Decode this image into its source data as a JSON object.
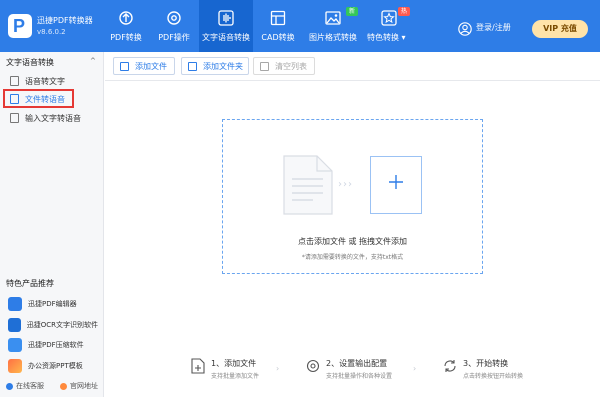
{
  "app": {
    "name": "迅捷PDF转换器",
    "version": "v8.6.0.2"
  },
  "nav": [
    {
      "label": "PDF转换"
    },
    {
      "label": "PDF操作"
    },
    {
      "label": "文字语音转换"
    },
    {
      "label": "CAD转换"
    },
    {
      "label": "图片格式转换",
      "badge": "新"
    },
    {
      "label": "特色转换 ▾",
      "badge": "热"
    }
  ],
  "header": {
    "login": "登录/注册",
    "vip": "VIP 充值"
  },
  "sidebar": {
    "section_title": "文字语音转换",
    "section_arrow": "^",
    "items": [
      {
        "label": "语音转文字"
      },
      {
        "label": "文件转语音"
      },
      {
        "label": "输入文字转语音"
      }
    ],
    "featured_title": "特色产品推荐",
    "featured": [
      {
        "label": "迅捷PDF编辑器"
      },
      {
        "label": "迅捷OCR文字识别软件"
      },
      {
        "label": "迅捷PDF压缩软件"
      },
      {
        "label": "办公资源PPT模板"
      }
    ],
    "links": {
      "support": "在线客服",
      "website": "官网地址"
    }
  },
  "toolbar": {
    "add_file": "添加文件",
    "add_folder": "添加文件夹",
    "clear_list": "清空列表"
  },
  "drop": {
    "arrows": "›››",
    "main": "点击添加文件 或 拖拽文件添加",
    "sub": "*请添加需要转换的文件，支持txt格式"
  },
  "steps": [
    {
      "title": "1、添加文件",
      "desc": "支持批量添加文件"
    },
    {
      "title": "2、设置输出配置",
      "desc": "支持批量操作和各种设置"
    },
    {
      "title": "3、开始转换",
      "desc": "点击转换按钮开始转换"
    }
  ],
  "colors": {
    "brand": "#2e7de7",
    "highlight": "#e53935",
    "vip": "#ffe3a9"
  }
}
